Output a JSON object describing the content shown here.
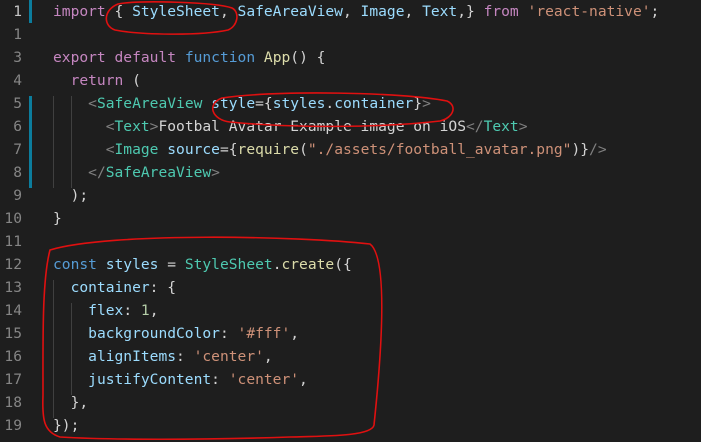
{
  "editor": {
    "colors": {
      "background": "#1e1e1e",
      "line_number": "#858585",
      "keyword_blue": "#569cd6",
      "keyword_purple": "#c586c0",
      "function": "#dcdcaa",
      "string": "#ce9178",
      "number": "#b5cea8",
      "variable": "#9cdcfe",
      "type": "#4ec9b0",
      "tag_bracket": "#808080",
      "annotation_red": "#e01010",
      "modified_bar": "#0c7d9d"
    },
    "lines": [
      {
        "num": "1",
        "tokens": [
          [
            "kw2",
            "import"
          ],
          [
            "t",
            " { "
          ],
          [
            "v",
            "StyleSheet"
          ],
          [
            "t",
            ", "
          ],
          [
            "v",
            "SafeAreaView"
          ],
          [
            "t",
            ", "
          ],
          [
            "v",
            "Image"
          ],
          [
            "t",
            ", "
          ],
          [
            "v",
            "Text"
          ],
          [
            "t",
            ",} "
          ],
          [
            "kw2",
            "from"
          ],
          [
            "t",
            " "
          ],
          [
            "s",
            "'react-native'"
          ],
          [
            "t",
            ";"
          ]
        ]
      },
      {
        "num": "1",
        "tokens": []
      },
      {
        "num": "3",
        "tokens": [
          [
            "kw2",
            "export"
          ],
          [
            "t",
            " "
          ],
          [
            "kw2",
            "default"
          ],
          [
            "t",
            " "
          ],
          [
            "kw",
            "function"
          ],
          [
            "t",
            " "
          ],
          [
            "f",
            "App"
          ],
          [
            "t",
            "() {"
          ]
        ]
      },
      {
        "num": "4",
        "tokens": [
          [
            "t",
            "  "
          ],
          [
            "kw2",
            "return"
          ],
          [
            "t",
            " ("
          ]
        ]
      },
      {
        "num": "5",
        "tokens": [
          [
            "t",
            "    "
          ],
          [
            "g",
            "<"
          ],
          [
            "ty",
            "SafeAreaView"
          ],
          [
            "t",
            " "
          ],
          [
            "v",
            "style"
          ],
          [
            "t",
            "={"
          ],
          [
            "v",
            "styles"
          ],
          [
            "t",
            "."
          ],
          [
            "v",
            "container"
          ],
          [
            "t",
            "}"
          ],
          [
            "g",
            ">"
          ]
        ]
      },
      {
        "num": "6",
        "tokens": [
          [
            "t",
            "      "
          ],
          [
            "g",
            "<"
          ],
          [
            "ty",
            "Text"
          ],
          [
            "g",
            ">"
          ],
          [
            "t",
            "Footbal Avatar Example image on iOS"
          ],
          [
            "g",
            "</"
          ],
          [
            "ty",
            "Text"
          ],
          [
            "g",
            ">"
          ]
        ]
      },
      {
        "num": "7",
        "tokens": [
          [
            "t",
            "      "
          ],
          [
            "g",
            "<"
          ],
          [
            "ty",
            "Image"
          ],
          [
            "t",
            " "
          ],
          [
            "v",
            "source"
          ],
          [
            "t",
            "={"
          ],
          [
            "f",
            "require"
          ],
          [
            "t",
            "("
          ],
          [
            "s",
            "\"./assets/football_avatar.png\""
          ],
          [
            "t",
            ")}"
          ],
          [
            "g",
            "/>"
          ]
        ]
      },
      {
        "num": "8",
        "tokens": [
          [
            "t",
            "    "
          ],
          [
            "g",
            "</"
          ],
          [
            "ty",
            "SafeAreaView"
          ],
          [
            "g",
            ">"
          ]
        ]
      },
      {
        "num": "9",
        "tokens": [
          [
            "t",
            "  );"
          ]
        ]
      },
      {
        "num": "10",
        "tokens": [
          [
            "t",
            "}"
          ]
        ]
      },
      {
        "num": "11",
        "tokens": []
      },
      {
        "num": "12",
        "tokens": [
          [
            "kw",
            "const"
          ],
          [
            "t",
            " "
          ],
          [
            "v",
            "styles"
          ],
          [
            "t",
            " = "
          ],
          [
            "ty",
            "StyleSheet"
          ],
          [
            "t",
            "."
          ],
          [
            "f",
            "create"
          ],
          [
            "t",
            "({"
          ]
        ]
      },
      {
        "num": "13",
        "tokens": [
          [
            "t",
            "  "
          ],
          [
            "v",
            "container"
          ],
          [
            "t",
            ": {"
          ]
        ]
      },
      {
        "num": "14",
        "tokens": [
          [
            "t",
            "    "
          ],
          [
            "v",
            "flex"
          ],
          [
            "t",
            ": "
          ],
          [
            "n",
            "1"
          ],
          [
            "t",
            ","
          ]
        ]
      },
      {
        "num": "15",
        "tokens": [
          [
            "t",
            "    "
          ],
          [
            "v",
            "backgroundColor"
          ],
          [
            "t",
            ": "
          ],
          [
            "s",
            "'#fff'"
          ],
          [
            "t",
            ","
          ]
        ]
      },
      {
        "num": "16",
        "tokens": [
          [
            "t",
            "    "
          ],
          [
            "v",
            "alignItems"
          ],
          [
            "t",
            ": "
          ],
          [
            "s",
            "'center'"
          ],
          [
            "t",
            ","
          ]
        ]
      },
      {
        "num": "17",
        "tokens": [
          [
            "t",
            "    "
          ],
          [
            "v",
            "justifyContent"
          ],
          [
            "t",
            ": "
          ],
          [
            "s",
            "'center'"
          ],
          [
            "t",
            ","
          ]
        ]
      },
      {
        "num": "18",
        "tokens": [
          [
            "t",
            "  },"
          ]
        ]
      },
      {
        "num": "19",
        "tokens": [
          [
            "t",
            "});"
          ]
        ]
      }
    ]
  }
}
